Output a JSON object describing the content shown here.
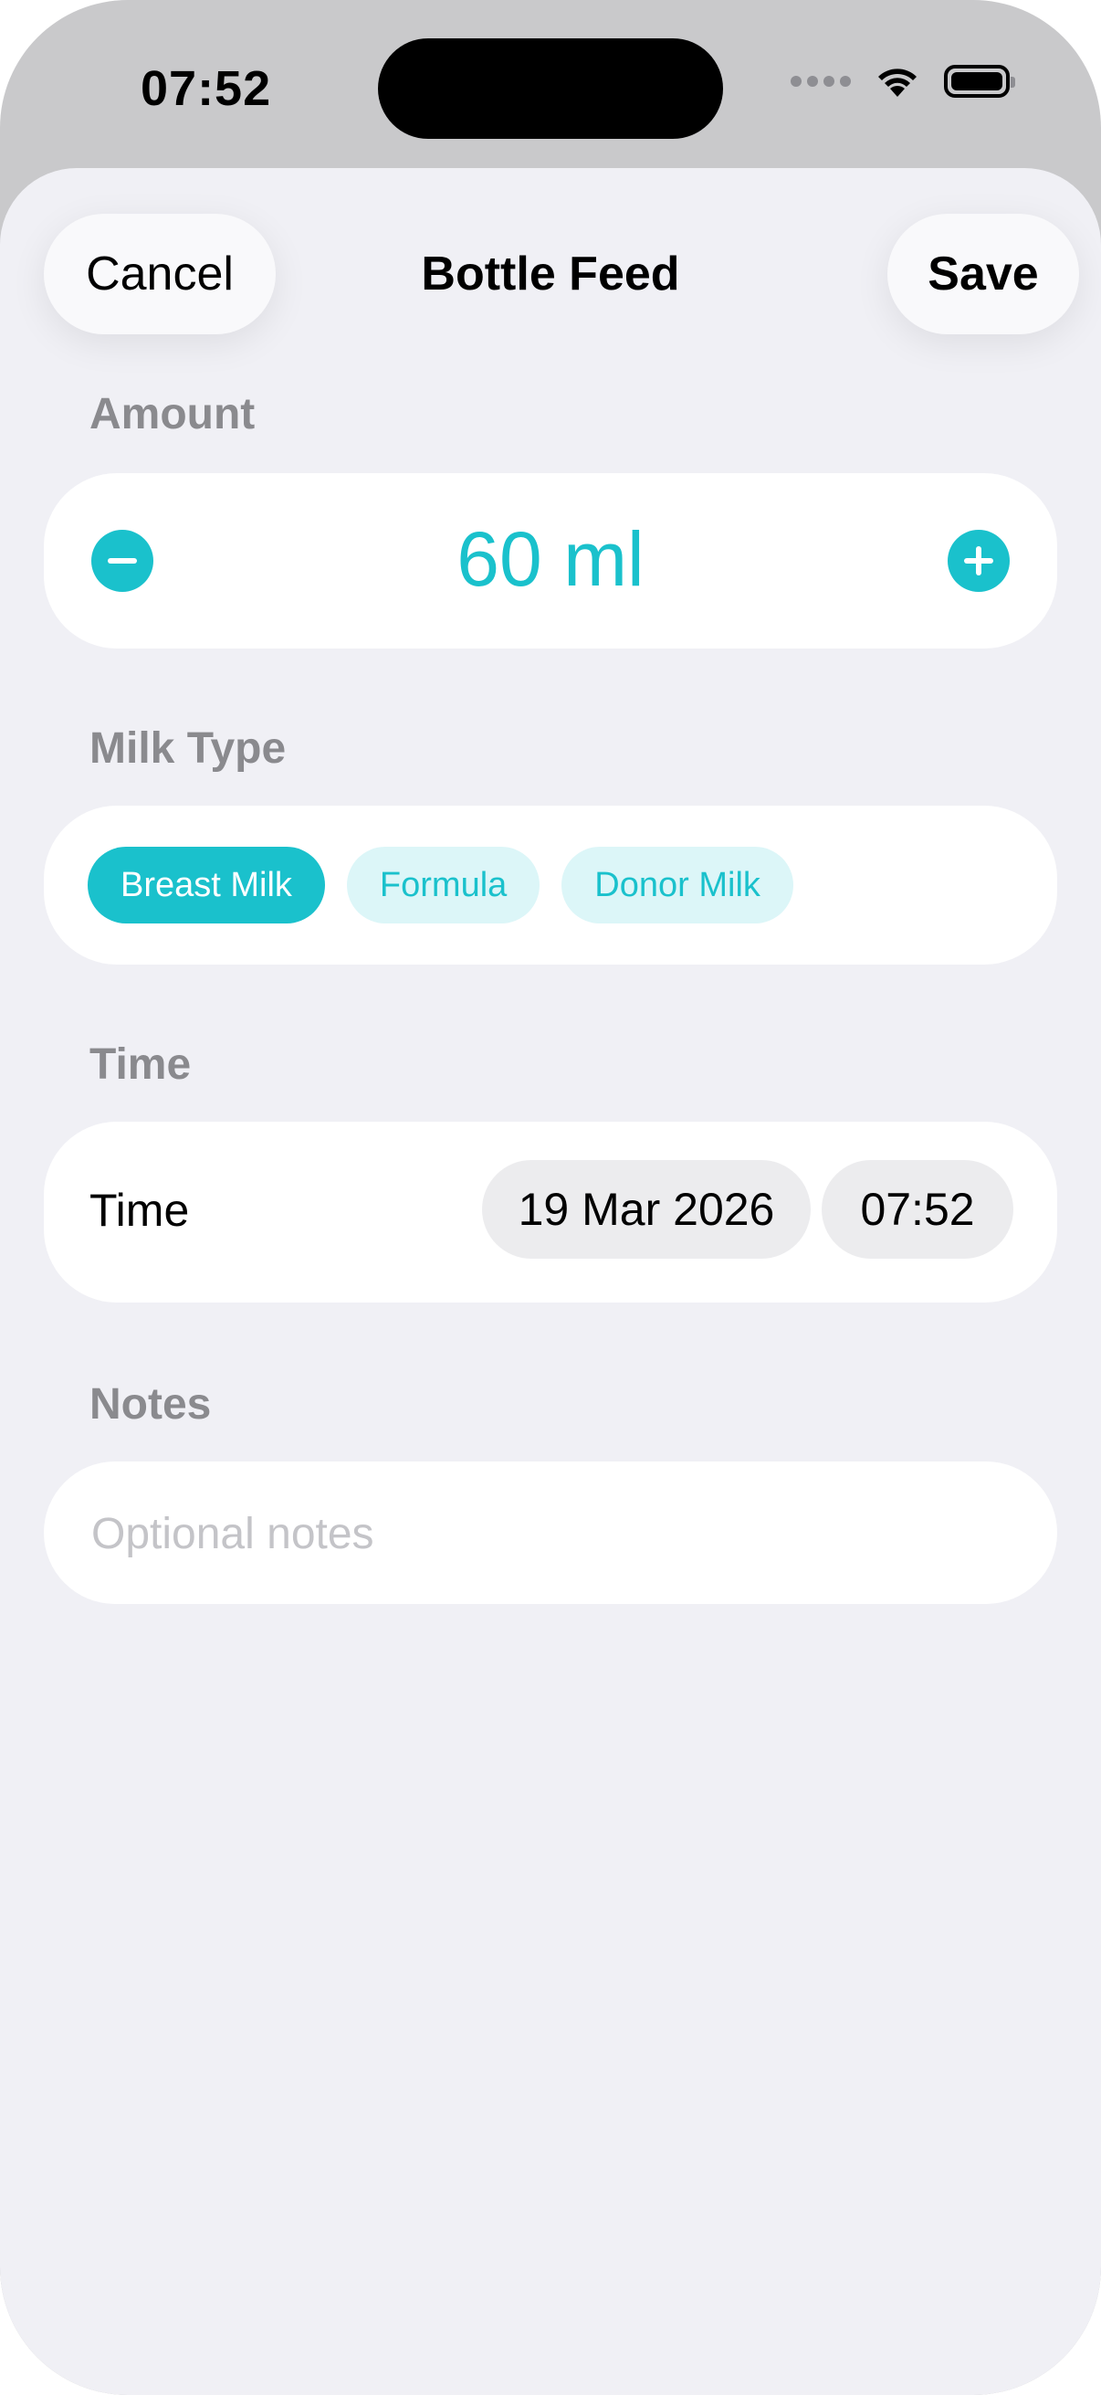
{
  "status_bar": {
    "time": "07:52"
  },
  "header": {
    "cancel_label": "Cancel",
    "title": "Bottle Feed",
    "save_label": "Save"
  },
  "amount": {
    "section_label": "Amount",
    "value": "60 ml"
  },
  "milk_type": {
    "section_label": "Milk Type",
    "options": [
      "Breast Milk",
      "Formula",
      "Donor Milk"
    ],
    "selected": "Breast Milk"
  },
  "time": {
    "section_label": "Time",
    "row_label": "Time",
    "date": "19 Mar 2026",
    "clock": "07:52"
  },
  "notes": {
    "section_label": "Notes",
    "placeholder": "Optional notes",
    "value": ""
  },
  "colors": {
    "accent": "#1ac1cc",
    "chip_inactive_bg": "#dcf6f8",
    "background": "#f0f0f5"
  },
  "icons": [
    "minus-circle-icon",
    "plus-circle-icon",
    "wifi-icon",
    "battery-icon",
    "signal-icon"
  ]
}
